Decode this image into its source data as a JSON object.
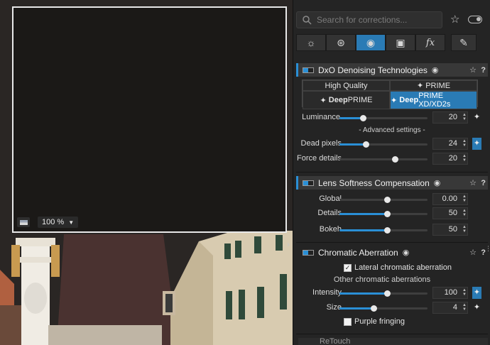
{
  "viewer": {
    "zoom_label": "100 %"
  },
  "search": {
    "placeholder": "Search for corrections..."
  },
  "tabs": [
    {
      "icon": "sun-icon",
      "glyph": "☼"
    },
    {
      "icon": "color-circles-icon",
      "glyph": "⊛"
    },
    {
      "icon": "lens-icon",
      "glyph": "◉"
    },
    {
      "icon": "layers-icon",
      "glyph": "▣"
    },
    {
      "icon": "fx-icon",
      "glyph": "ƒx"
    },
    {
      "icon": "brush-icon",
      "glyph": "✎"
    }
  ],
  "denoise": {
    "title": "DxO Denoising Technologies",
    "modes": {
      "high_quality": "High Quality",
      "prime": "✦ PRIME",
      "deepprime_bold": "Deep",
      "deepprime_rest": "PRIME",
      "deepprime_xd_bold": "Deep",
      "deepprime_xd_rest": "PRIME XD/XD2s"
    },
    "luminance": {
      "label": "Luminance",
      "value": "20"
    },
    "advanced": "- Advanced settings -",
    "dead_pixels": {
      "label": "Dead pixels",
      "value": "24"
    },
    "force_details": {
      "label": "Force details",
      "value": "20"
    }
  },
  "lens_softness": {
    "title": "Lens Softness Compensation",
    "global": {
      "label": "Global",
      "value": "0.00"
    },
    "details": {
      "label": "Details",
      "value": "50"
    },
    "bokeh": {
      "label": "Bokeh",
      "value": "50"
    }
  },
  "chromatic": {
    "title": "Chromatic Aberration",
    "lateral": "Lateral chromatic aberration",
    "other": "Other chromatic aberrations",
    "intensity": {
      "label": "Intensity",
      "value": "100"
    },
    "size": {
      "label": "Size",
      "value": "4"
    },
    "purple": "Purple fringing"
  },
  "retouch": {
    "title": "ReTouch"
  },
  "colors": {
    "accent": "#2a7bb5",
    "panel": "#242424"
  }
}
